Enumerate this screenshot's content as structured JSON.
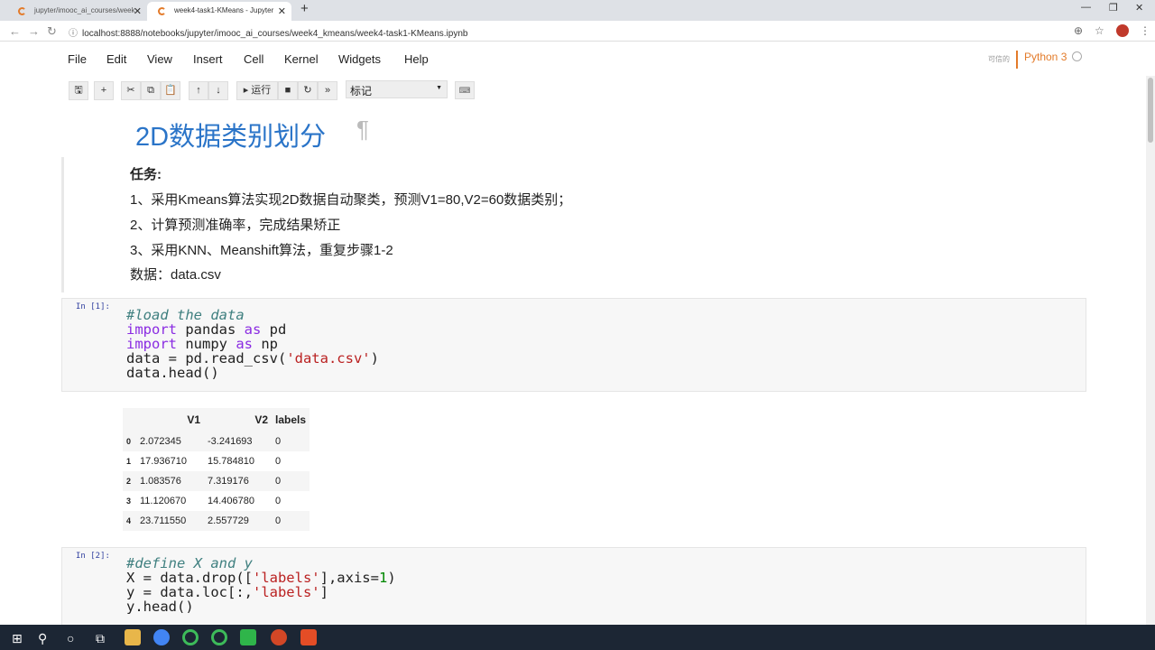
{
  "browser": {
    "tabs": [
      {
        "title": "jupyter/imooc_ai_courses/week"
      },
      {
        "title": "week4-task1-KMeans - Jupyter"
      }
    ],
    "url": "localhost:8888/notebooks/jupyter/imooc_ai_courses/week4_kmeans/week4-task1-KMeans.ipynb"
  },
  "menu": {
    "items": [
      "File",
      "Edit",
      "View",
      "Insert",
      "Cell",
      "Kernel",
      "Widgets",
      "Help"
    ],
    "trusted": "可信的",
    "kernel": "Python 3"
  },
  "toolbar": {
    "run_label": "运行",
    "cell_type": "标记"
  },
  "markdown": {
    "title": "2D数据类别划分",
    "pilcrow": "¶",
    "task_header": "任务:",
    "lines": [
      "1、采用Kmeans算法实现2D数据自动聚类，预测V1=80,V2=60数据类别；",
      "2、计算预测准确率，完成结果矫正",
      "3、采用KNN、Meanshift算法，重复步骤1-2",
      "数据：data.csv"
    ]
  },
  "cells": [
    {
      "prompt": "In [1]:"
    },
    {
      "prompt": "In [2]:"
    }
  ],
  "dataframe": {
    "columns": [
      "",
      "V1",
      "V2",
      "labels"
    ],
    "rows": [
      [
        "0",
        "2.072345",
        "-3.241693",
        "0"
      ],
      [
        "1",
        "17.936710",
        "15.784810",
        "0"
      ],
      [
        "2",
        "1.083576",
        "7.319176",
        "0"
      ],
      [
        "3",
        "11.120670",
        "14.406780",
        "0"
      ],
      [
        "4",
        "23.711550",
        "2.557729",
        "0"
      ]
    ]
  }
}
